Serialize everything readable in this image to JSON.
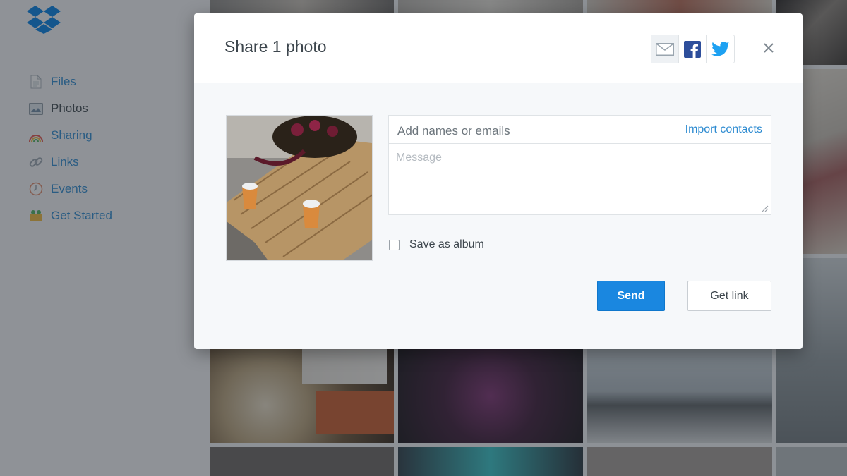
{
  "sidebar": {
    "logo_icon": "dropbox-logo",
    "items": [
      {
        "label": "Files",
        "icon": "file-icon",
        "active": false
      },
      {
        "label": "Photos",
        "icon": "photo-icon",
        "active": true
      },
      {
        "label": "Sharing",
        "icon": "rainbow-icon",
        "active": false
      },
      {
        "label": "Links",
        "icon": "link-icon",
        "active": false
      },
      {
        "label": "Events",
        "icon": "clock-icon",
        "active": false
      },
      {
        "label": "Get Started",
        "icon": "box-icon",
        "active": false
      }
    ]
  },
  "dialog": {
    "title": "Share 1 photo",
    "share_options": [
      "email-icon",
      "facebook-icon",
      "twitter-icon"
    ],
    "recipients": {
      "placeholder": "Add names or emails",
      "value": ""
    },
    "import_contacts": "Import contacts",
    "message": {
      "placeholder": "Message",
      "value": ""
    },
    "save_as_album": {
      "label": "Save as album",
      "checked": false
    },
    "send_label": "Send",
    "get_link_label": "Get link"
  },
  "colors": {
    "accent": "#1a87e0",
    "link": "#2d8bd1",
    "text": "#3d464d",
    "facebook": "#2d4e9b",
    "twitter": "#1da1f2"
  }
}
